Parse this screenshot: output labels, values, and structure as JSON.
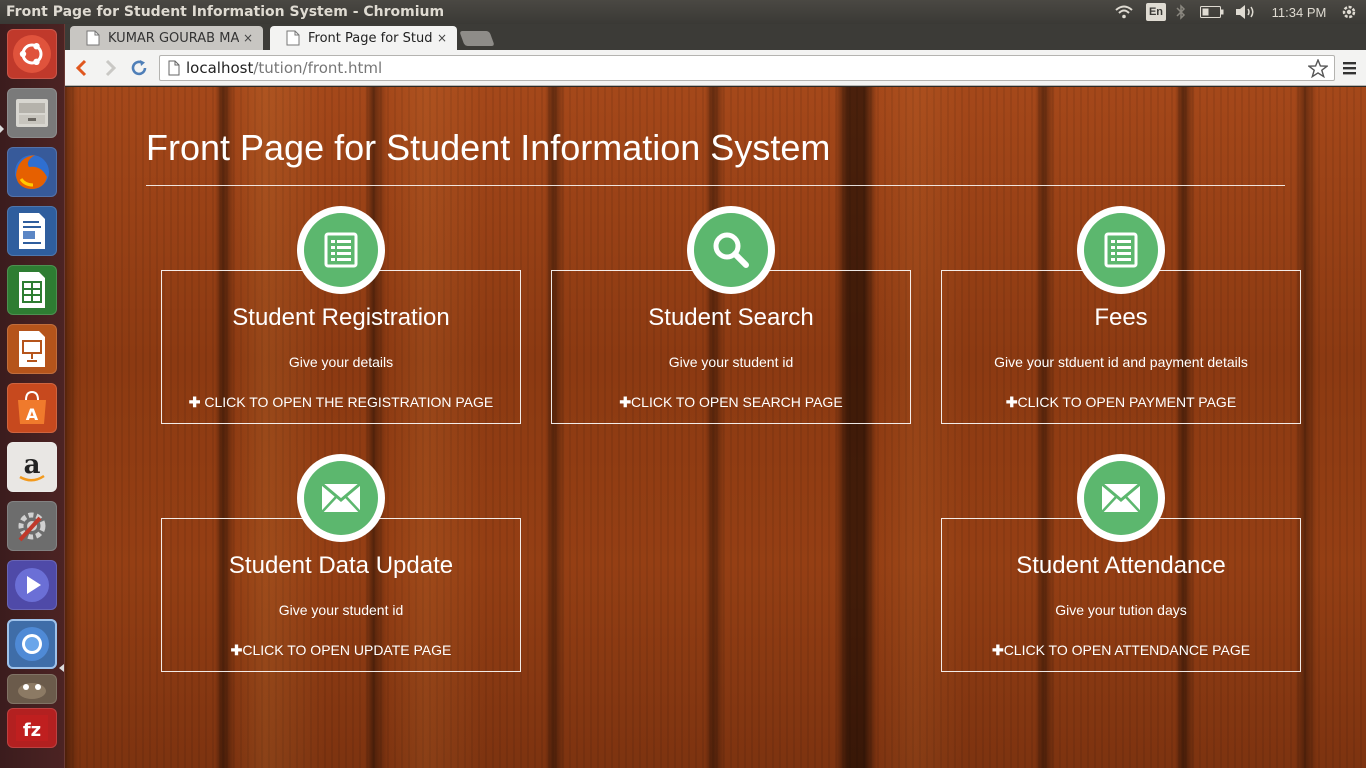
{
  "window": {
    "title": "Front Page for Student Information System - Chromium"
  },
  "tray": {
    "language": "En",
    "clock": "11:34 PM"
  },
  "launcher": {
    "items": [
      "ubuntu-dash",
      "files",
      "firefox",
      "libreoffice-writer",
      "libreoffice-calc",
      "libreoffice-impress",
      "ubuntu-software-center",
      "amazon",
      "system-settings",
      "media-player",
      "chromium",
      "gimp",
      "filezilla"
    ]
  },
  "tabs": [
    {
      "label": "KUMAR GOURAB MA",
      "close": "×"
    },
    {
      "label": "Front Page for Stud",
      "close": "×"
    }
  ],
  "omnibox": {
    "host": "localhost",
    "path": "/tution/front.html"
  },
  "page": {
    "title": "Front Page for Student Information System",
    "cards": [
      {
        "icon": "list-icon",
        "title": "Student Registration",
        "desc": "Give your details",
        "link": "CLICK TO OPEN THE REGISTRATION PAGE",
        "link_prefix": "✚ "
      },
      {
        "icon": "search-icon",
        "title": "Student Search",
        "desc": "Give your student id",
        "link": "CLICK TO OPEN SEARCH PAGE",
        "link_prefix": "✚"
      },
      {
        "icon": "list-icon",
        "title": "Fees",
        "desc": "Give your stduent id and payment details",
        "link": "CLICK TO OPEN PAYMENT PAGE",
        "link_prefix": "✚"
      },
      {
        "icon": "envelope-icon",
        "title": "Student Data Update",
        "desc": "Give your student id",
        "link": "CLICK TO OPEN UPDATE PAGE",
        "link_prefix": "✚"
      },
      {
        "icon": "envelope-icon",
        "title": "Student Attendance",
        "desc": "Give your tution days",
        "link": "CLICK TO OPEN ATTENDANCE PAGE",
        "link_prefix": "✚"
      }
    ]
  },
  "colors": {
    "accent_green": "#5cb76e",
    "wood": "#8f3d12"
  }
}
